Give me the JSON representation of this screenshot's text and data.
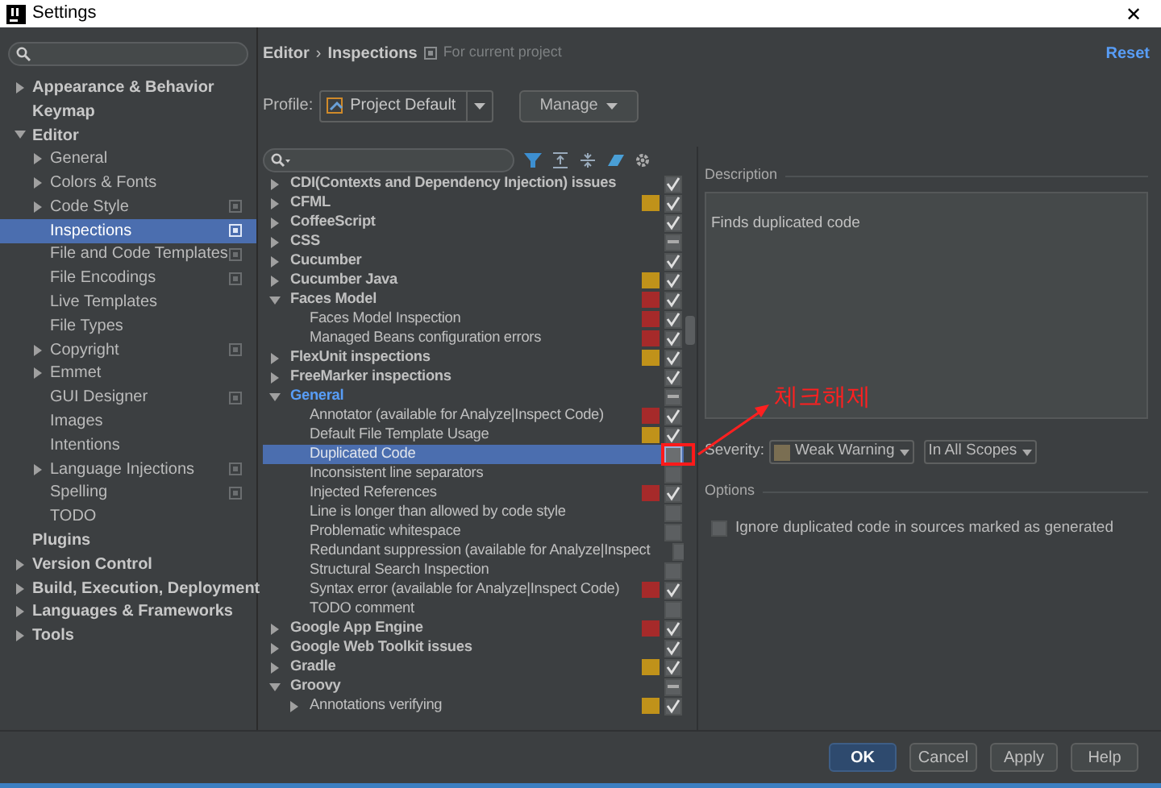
{
  "window": {
    "title": "Settings",
    "close": "✕"
  },
  "sidebar": {
    "items": [
      {
        "label": "Appearance & Behavior",
        "expanded": false
      },
      {
        "label": "Keymap"
      },
      {
        "label": "Editor",
        "expanded": true,
        "children": [
          {
            "label": "General",
            "expanded": false
          },
          {
            "label": "Colors & Fonts",
            "expanded": false
          },
          {
            "label": "Code Style",
            "expanded": false,
            "project_scoped": true
          },
          {
            "label": "Inspections",
            "selected": true,
            "project_scoped": true
          },
          {
            "label": "File and Code Templates",
            "project_scoped": true
          },
          {
            "label": "File Encodings",
            "project_scoped": true
          },
          {
            "label": "Live Templates"
          },
          {
            "label": "File Types"
          },
          {
            "label": "Copyright",
            "expanded": false,
            "project_scoped": true
          },
          {
            "label": "Emmet",
            "expanded": false
          },
          {
            "label": "GUI Designer",
            "project_scoped": true
          },
          {
            "label": "Images"
          },
          {
            "label": "Intentions"
          },
          {
            "label": "Language Injections",
            "expanded": false,
            "project_scoped": true
          },
          {
            "label": "Spelling",
            "project_scoped": true
          },
          {
            "label": "TODO"
          }
        ]
      },
      {
        "label": "Plugins"
      },
      {
        "label": "Version Control",
        "expanded": false
      },
      {
        "label": "Build, Execution, Deployment",
        "expanded": false
      },
      {
        "label": "Languages & Frameworks",
        "expanded": false
      },
      {
        "label": "Tools",
        "expanded": false
      }
    ]
  },
  "breadcrumb": {
    "parent": "Editor",
    "separator": "›",
    "current": "Inspections",
    "scope": "For current project"
  },
  "reset": "Reset",
  "profile": {
    "label": "Profile:",
    "value": "Project Default",
    "manage": "Manage"
  },
  "inspections": [
    {
      "label": "CDI(Contexts and Dependency Injection) issues",
      "expanded": false,
      "checked": true,
      "mixed": false
    },
    {
      "label": "CFML",
      "expanded": false,
      "color": "#c0921a",
      "checked": true,
      "mixed": false
    },
    {
      "label": "CoffeeScript",
      "expanded": false,
      "checked": true,
      "mixed": false
    },
    {
      "label": "CSS",
      "expanded": false,
      "checked": true,
      "mixed": true
    },
    {
      "label": "Cucumber",
      "expanded": false,
      "checked": true,
      "mixed": false
    },
    {
      "label": "Cucumber Java",
      "expanded": false,
      "color": "#c0921a",
      "checked": true,
      "mixed": false
    },
    {
      "label": "Faces Model",
      "expanded": true,
      "color": "#a62a2a",
      "checked": true,
      "mixed": false,
      "children": [
        {
          "label": "Faces Model Inspection",
          "color": "#a62a2a",
          "checked": true,
          "mixed": false
        },
        {
          "label": "Managed Beans configuration errors",
          "color": "#a62a2a",
          "checked": true,
          "mixed": false
        }
      ]
    },
    {
      "label": "FlexUnit inspections",
      "expanded": false,
      "color": "#c0921a",
      "checked": true,
      "mixed": false
    },
    {
      "label": "FreeMarker inspections",
      "expanded": false,
      "checked": true,
      "mixed": false
    },
    {
      "label": "General",
      "expanded": true,
      "modified": true,
      "checked": true,
      "mixed": true,
      "children": [
        {
          "label": "Annotator (available for Analyze|Inspect Code)",
          "color": "#a62a2a",
          "checked": true,
          "mixed": false
        },
        {
          "label": "Default File Template Usage",
          "color": "#c0921a",
          "checked": true,
          "mixed": false
        },
        {
          "label": "Duplicated Code",
          "selected": true,
          "checked": false,
          "mixed": false
        },
        {
          "label": "Inconsistent line separators",
          "checked": false,
          "mixed": false
        },
        {
          "label": "Injected References",
          "color": "#a62a2a",
          "checked": true,
          "mixed": false
        },
        {
          "label": "Line is longer than allowed by code style",
          "checked": false,
          "mixed": false
        },
        {
          "label": "Problematic whitespace",
          "checked": false,
          "mixed": false
        },
        {
          "label": "Redundant suppression (available for Analyze|Inspect",
          "checked": false,
          "mixed": false
        },
        {
          "label": "Structural Search Inspection",
          "checked": false,
          "mixed": false
        },
        {
          "label": "Syntax error (available for Analyze|Inspect Code)",
          "color": "#a62a2a",
          "checked": true,
          "mixed": false
        },
        {
          "label": "TODO comment",
          "checked": false,
          "mixed": false
        }
      ]
    },
    {
      "label": "Google App Engine",
      "expanded": false,
      "color": "#a62a2a",
      "checked": true,
      "mixed": false
    },
    {
      "label": "Google Web Toolkit issues",
      "expanded": false,
      "checked": true,
      "mixed": false
    },
    {
      "label": "Gradle",
      "expanded": false,
      "color": "#c0921a",
      "checked": true,
      "mixed": false
    },
    {
      "label": "Groovy",
      "expanded": true,
      "checked": true,
      "mixed": true,
      "children": [
        {
          "label": "Annotations verifying",
          "expanded": false,
          "color": "#c0921a",
          "checked": true,
          "mixed": false
        }
      ]
    }
  ],
  "description": {
    "title": "Description",
    "text": "Finds duplicated code"
  },
  "severity": {
    "label": "Severity:",
    "value": "Weak Warning",
    "color": "#7a6e52",
    "scope": "In All Scopes"
  },
  "options": {
    "title": "Options",
    "items": [
      {
        "label": "Ignore duplicated code in sources marked as generated",
        "checked": false
      }
    ]
  },
  "annotation": {
    "text": "체크해제"
  },
  "buttons": [
    {
      "label": "OK",
      "primary": true
    },
    {
      "label": "Cancel",
      "primary": false
    },
    {
      "label": "Apply",
      "primary": false
    },
    {
      "label": "Help",
      "primary": false
    }
  ]
}
